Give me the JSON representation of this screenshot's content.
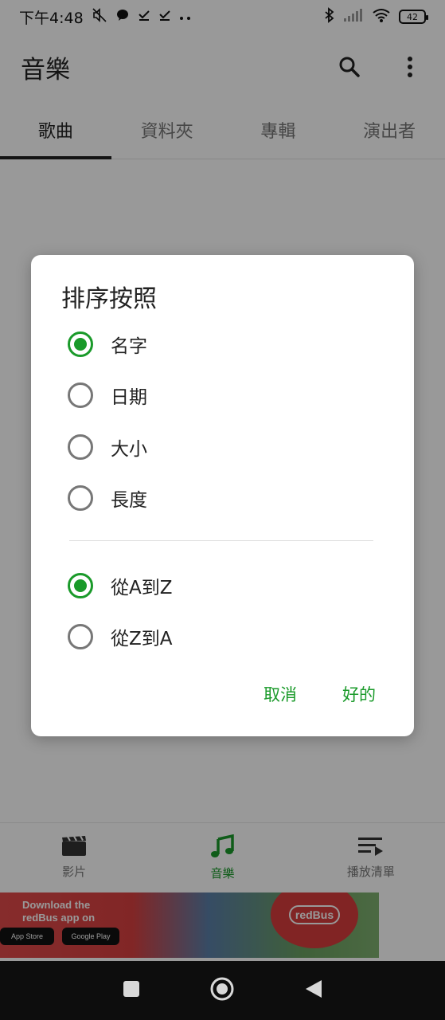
{
  "status_bar": {
    "time": "下午4:48",
    "battery": "42"
  },
  "appbar": {
    "title": "音樂"
  },
  "tabs": [
    {
      "label": "歌曲",
      "active": true
    },
    {
      "label": "資料夾",
      "active": false
    },
    {
      "label": "專輯",
      "active": false
    },
    {
      "label": "演出者",
      "active": false
    }
  ],
  "dialog": {
    "title": "排序按照",
    "sort_options": [
      {
        "label": "名字",
        "checked": true
      },
      {
        "label": "日期",
        "checked": false
      },
      {
        "label": "大小",
        "checked": false
      },
      {
        "label": "長度",
        "checked": false
      }
    ],
    "order_options": [
      {
        "label": "從A到Z",
        "checked": true
      },
      {
        "label": "從Z到A",
        "checked": false
      }
    ],
    "cancel_label": "取消",
    "ok_label": "好的"
  },
  "bottom_nav": [
    {
      "label": "影片",
      "icon": "movie-icon",
      "active": false
    },
    {
      "label": "音樂",
      "icon": "music-note-icon",
      "active": true
    },
    {
      "label": "播放清單",
      "icon": "playlist-icon",
      "active": false
    }
  ],
  "ad": {
    "line1": "Download the",
    "line2": "redBus app on",
    "app_store": "App Store",
    "google_play": "Google Play",
    "brand": "redBus"
  },
  "colors": {
    "accent": "#1a9a2a",
    "scrim": "rgba(0,0,0,0.40)"
  }
}
